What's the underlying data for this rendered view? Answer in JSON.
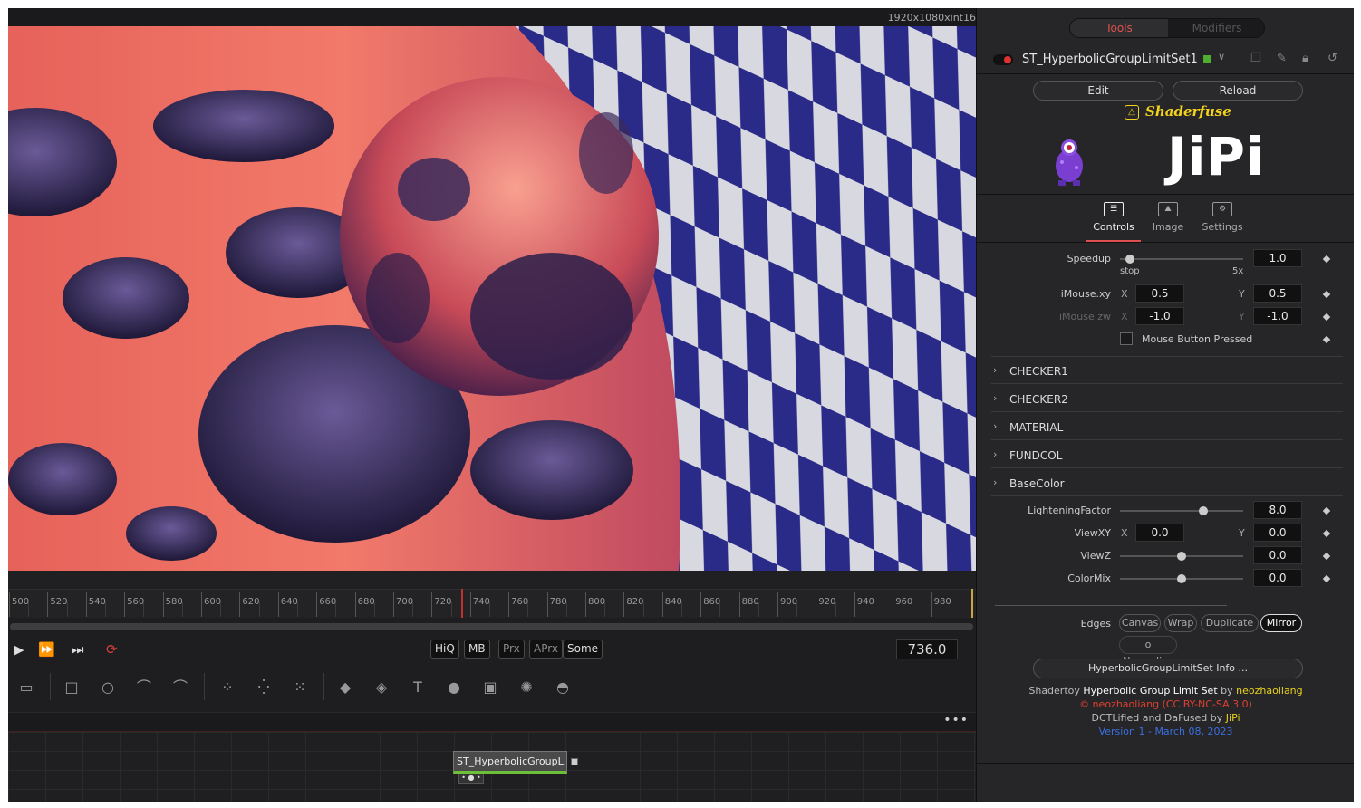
{
  "viewer": {
    "resolution": "1920x1080xint16"
  },
  "timeline": {
    "ticks": [
      "500",
      "520",
      "540",
      "560",
      "580",
      "600",
      "620",
      "640",
      "660",
      "680",
      "700",
      "720",
      "740",
      "760",
      "780",
      "800",
      "820",
      "840",
      "860",
      "880",
      "900",
      "920",
      "940",
      "960",
      "980"
    ],
    "current_frame": "736.0"
  },
  "transport": {
    "quality_buttons": [
      "HiQ",
      "MB",
      "Prx",
      "APrx",
      "Some"
    ]
  },
  "node": {
    "label": "ST_HyperbolicGroupL..."
  },
  "inspector": {
    "tabs": {
      "tools": "Tools",
      "modifiers": "Modifiers"
    },
    "tool_name": "ST_HyperbolicGroupLimitSet1",
    "tool_color": "#4caf30",
    "edit_label": "Edit",
    "reload_label": "Reload",
    "shaderfuse_label": "Shaderfuse",
    "logo_text": "JiPi",
    "control_tabs": [
      "Controls",
      "Image",
      "Settings"
    ],
    "speedup": {
      "label": "Speedup",
      "value": "1.0",
      "min_label": "stop",
      "max_label": "5x",
      "level": 0.08
    },
    "imouse_xy": {
      "label": "iMouse.xy",
      "x_label": "X",
      "x": "0.5",
      "y_label": "Y",
      "y": "0.5"
    },
    "imouse_zw": {
      "label": "iMouse.zw",
      "x_label": "X",
      "x": "-1.0",
      "y_label": "Y",
      "y": "-1.0"
    },
    "mouse_button": "Mouse Button Pressed",
    "sections": [
      "CHECKER1",
      "CHECKER2",
      "MATERIAL",
      "FUNDCOL",
      "BaseColor"
    ],
    "lightening": {
      "label": "LighteningFactor",
      "value": "8.0",
      "level": 0.68
    },
    "viewxy": {
      "label": "ViewXY",
      "x_label": "X",
      "x": "0.0",
      "y_label": "Y",
      "y": "0.0"
    },
    "viewz": {
      "label": "ViewZ",
      "value": "0.0",
      "level": 0.5
    },
    "colormix": {
      "label": "ColorMix",
      "value": "0.0",
      "level": 0.5
    },
    "edges": {
      "label": "Edges",
      "options": [
        "Canvas",
        "Wrap",
        "Duplicate",
        "Mirror"
      ],
      "selected": "Mirror"
    },
    "normalize": "o Normalize",
    "info_button": "HyperbolicGroupLimitSet Info ...",
    "credits": {
      "line1_a": "Shadertoy",
      "line1_b": "Hyperbolic Group Limit Set",
      "line1_c": "by",
      "line1_d": "neozhaoliang",
      "line2": "© neozhaoliang (CC BY-NC-SA 3.0)",
      "line3_a": "DCTLified and DaFused by",
      "line3_b": "JiPi",
      "line4": "Version 1 - March 08, 2023"
    }
  }
}
